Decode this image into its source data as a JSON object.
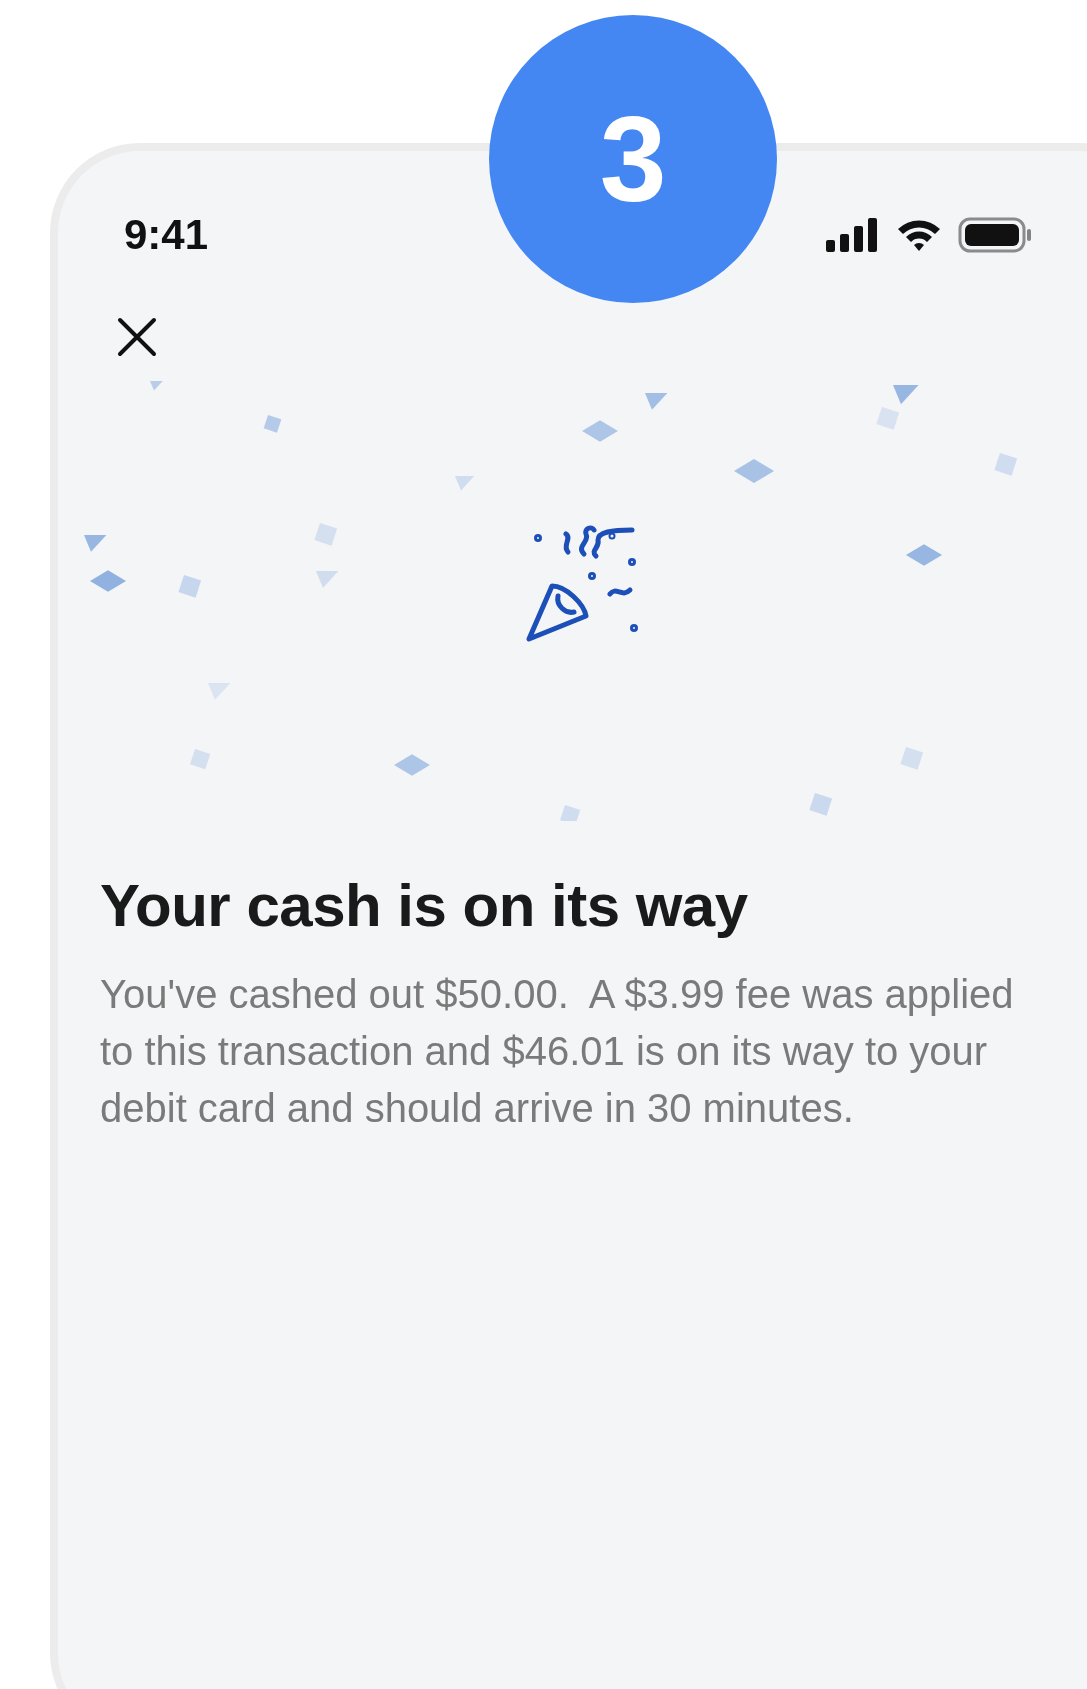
{
  "step_badge": "3",
  "status_bar": {
    "time": "9:41"
  },
  "heading": "Your cash is on its way",
  "message": "You've cashed out $50.00.  A $3.99 fee was applied to this transaction and $46.01 is on its way to your debit card and should arrive in 30 minutes."
}
